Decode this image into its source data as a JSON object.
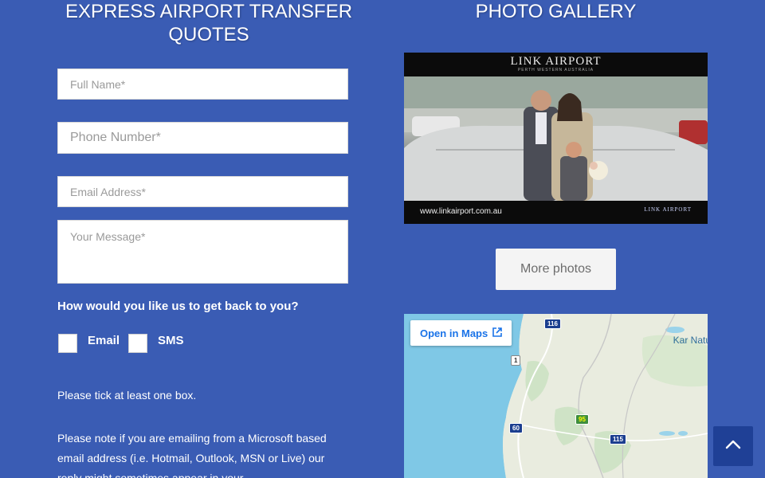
{
  "quote_form": {
    "heading": "EXPRESS AIRPORT TRANSFER QUOTES",
    "full_name_placeholder": "Full Name*",
    "phone_placeholder": "Phone Number*",
    "email_placeholder": "Email Address*",
    "message_placeholder": "Your Message*",
    "contact_question": "How would you like us to get back to you?",
    "options": [
      {
        "label": "Email",
        "checked": false
      },
      {
        "label": "SMS",
        "checked": false
      }
    ],
    "tick_note": "Please tick at least one box.",
    "ms_note": "Please note if you are emailing from a Microsoft based email address (i.e. Hotmail, Outlook, MSN or Live) our reply might sometimes appear in your"
  },
  "gallery": {
    "heading": "PHOTO GALLERY",
    "photo": {
      "logo_text": "LINK AIRPORT",
      "logo_subtext": "PERTH WESTERN AUSTRALIA",
      "url_text": "www.linkairport.com.au",
      "footer_logo": "LINK AIRPORT"
    },
    "more_photos_label": "More photos"
  },
  "map": {
    "open_in_maps_label": "Open in Maps",
    "place_label": "Kar Natu",
    "road_badges": [
      "116",
      "1",
      "95",
      "60",
      "115"
    ]
  },
  "colors": {
    "background": "#3a5cb4",
    "scroll_button": "#1f4096",
    "maps_link": "#1a73e8"
  },
  "icons": [
    "open-external-icon",
    "chevron-up-icon"
  ]
}
